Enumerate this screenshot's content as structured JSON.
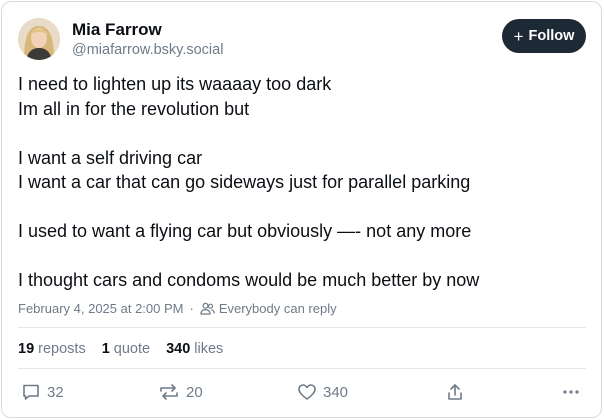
{
  "author": {
    "name": "Mia Farrow",
    "handle": "@miafarrow.bsky.social"
  },
  "follow_button": {
    "label": "Follow",
    "icon": "plus-icon"
  },
  "post": {
    "lines": [
      "I need to lighten up its waaaay too dark",
      "Im all in for the revolution but",
      "",
      "I want a self driving car",
      "I want a car that can go sideways just for parallel parking",
      "",
      "I used to want a flying car but obviously —- not any more",
      "",
      "I thought cars and condoms would  be much better by now"
    ]
  },
  "meta": {
    "timestamp": "February 4, 2025 at 2:00 PM",
    "separator": "·",
    "reply_setting": "Everybody can reply"
  },
  "stats": {
    "reposts_count": "19",
    "reposts_label": "reposts",
    "quotes_count": "1",
    "quotes_label": "quote",
    "likes_count": "340",
    "likes_label": "likes"
  },
  "actions": {
    "reply_count": "32",
    "repost_count": "20",
    "like_count": "340"
  },
  "colors": {
    "follow_bg": "#1e2936",
    "muted_text": "#6f7b88",
    "border": "#d4dbe2"
  }
}
